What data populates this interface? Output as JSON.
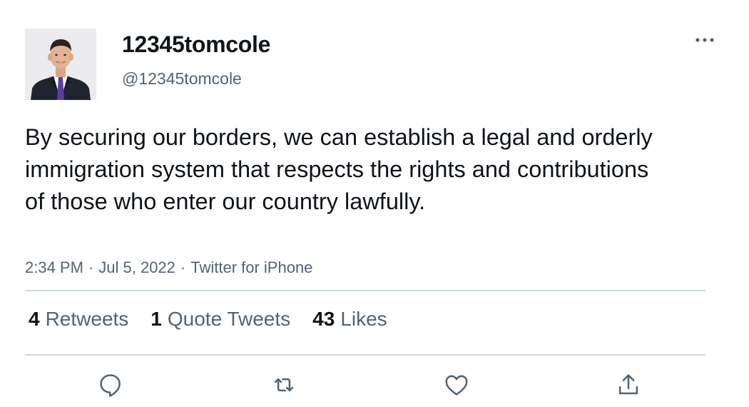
{
  "user": {
    "display_name": "12345tomcole",
    "handle": "@12345tomcole"
  },
  "tweet": {
    "text": "By securing our borders, we can establish a legal and orderly immigration system that respects the rights and contributions of those who enter our country lawfully.",
    "time": "2:34 PM",
    "separator": "·",
    "date": "Jul 5, 2022",
    "source": "Twitter for iPhone"
  },
  "stats": {
    "retweets_count": "4",
    "retweets_label": "Retweets",
    "quotes_count": "1",
    "quotes_label": "Quote Tweets",
    "likes_count": "43",
    "likes_label": "Likes"
  },
  "actions": [
    "reply-icon",
    "retweet-icon",
    "like-icon",
    "share-icon"
  ],
  "colors": {
    "text_primary": "#0f1419",
    "text_secondary": "#536471",
    "divider": "#cfd9de"
  }
}
